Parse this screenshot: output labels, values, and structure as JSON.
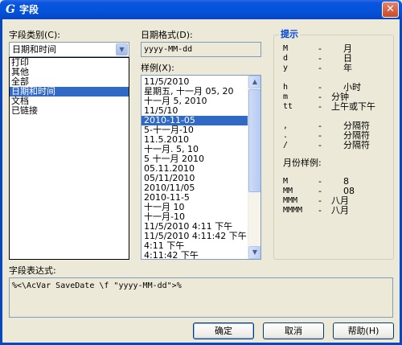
{
  "window": {
    "title": "字段",
    "app_icon": "G",
    "close": "✕"
  },
  "category": {
    "label": "字段类别(C):",
    "selected": "日期和时间",
    "items": [
      "打印",
      "其他",
      "全部",
      "日期和时间",
      "文档",
      "已链接"
    ],
    "selected_index": 3
  },
  "date_format": {
    "label": "日期格式(D):",
    "value": "yyyy-MM-dd"
  },
  "examples": {
    "label": "样例(X):",
    "items": [
      "11/5/2010",
      "星期五, 十一月 05, 20",
      "十一月 5, 2010",
      "11/5/10",
      "2010-11-05",
      "5-十一月-10",
      "11.5.2010",
      "十一月. 5, 10",
      "5 十一月 2010",
      "05.11.2010",
      "05/11/2010",
      "2010/11/05",
      "2010-11-5",
      "十一月 10",
      "十一月-10",
      "11/5/2010 4:11 下午",
      "11/5/2010 4:11:42 下午",
      "4:11 下午",
      "4:11:42 下午"
    ],
    "selected_index": 4
  },
  "hints": {
    "title": "提示",
    "rows": [
      {
        "code": "M",
        "dash": "-",
        "meaning": "月"
      },
      {
        "code": "d",
        "dash": "-",
        "meaning": "日"
      },
      {
        "code": "y",
        "dash": "-",
        "meaning": "年"
      },
      {
        "code": "h",
        "dash": "-",
        "meaning": "小时"
      },
      {
        "code": "m",
        "dash": "-",
        "meaning": "分钟"
      },
      {
        "code": "tt",
        "dash": "-",
        "meaning": "上午或下午"
      },
      {
        "code": ",",
        "dash": "-",
        "meaning": "分隔符"
      },
      {
        "code": ".",
        "dash": "-",
        "meaning": "分隔符"
      },
      {
        "code": "/",
        "dash": "-",
        "meaning": "分隔符"
      }
    ],
    "month_examples_label": "月份样例:",
    "month_rows": [
      {
        "code": "M",
        "dash": "-",
        "meaning": "8"
      },
      {
        "code": "MM",
        "dash": "-",
        "meaning": "08"
      },
      {
        "code": "MMM",
        "dash": "-",
        "meaning": "八月"
      },
      {
        "code": "MMMM",
        "dash": "-",
        "meaning": "八月"
      }
    ]
  },
  "expression": {
    "label": "字段表达式:",
    "value": "%<\\AcVar SaveDate \\f \"yyyy-MM-dd\">%"
  },
  "buttons": {
    "ok": "确定",
    "cancel": "取消",
    "help": "帮助(H)"
  },
  "icons": {
    "dropdown": "chevron-down-icon",
    "scroll_up": "arrow-up-icon",
    "scroll_down": "arrow-down-icon"
  }
}
